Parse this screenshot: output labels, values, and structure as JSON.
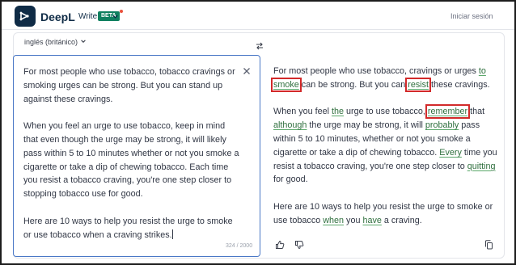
{
  "header": {
    "brand": "DeepL",
    "brand_sub": "Write",
    "beta": "BETA",
    "signin": "Iniciar sesión"
  },
  "toolbar": {
    "language": "inglés (británico)"
  },
  "input": {
    "paragraphs": [
      "For most people who use tobacco, tobacco cravings or smoking urges can be strong. But you can stand up against these cravings.",
      "When you feel an urge to use tobacco, keep in mind that even though the urge may be strong, it will likely pass within 5 to 10 minutes whether or not you smoke a cigarette or take a dip of chewing tobacco. Each time you resist a tobacco craving, you're one step closer to stopping tobacco use for good.",
      "Here are 10 ways to help you resist the urge to smoke or use tobacco when a craving strikes."
    ],
    "counter": "324 / 2000"
  },
  "output": {
    "p1": {
      "a": "For most people who use tobacco, cravings or urges ",
      "b": "to",
      "c": " ",
      "d": "smoke",
      "e": " can be strong. But you can ",
      "f": "resist",
      "g": " these cravings."
    },
    "p2": {
      "a": "When you feel ",
      "b": "the",
      "c": " urge to use tobacco, ",
      "d": "remember",
      "e": " that ",
      "f": "although",
      "g": " the urge may be strong, it will ",
      "h": "probably",
      "i": " pass within 5 to 10 minutes, whether or not you smoke a cigarette or take a dip of chewing tobacco. ",
      "j": "Every",
      "k": " time you resist a tobacco craving, you're one step closer to ",
      "l": "quitting",
      "m": " for good."
    },
    "p3": {
      "a": "Here are 10 ways to help you resist the urge to smoke or use tobacco ",
      "b": "when",
      "c": " you ",
      "d": "have",
      "e": " a craving."
    }
  },
  "colors": {
    "brand": "#0f2b46",
    "beta_bg": "#0f7f5f",
    "highlight_box": "#d22a2a",
    "change_underline": "#5ba86a",
    "focus_border": "#4a78c6"
  }
}
